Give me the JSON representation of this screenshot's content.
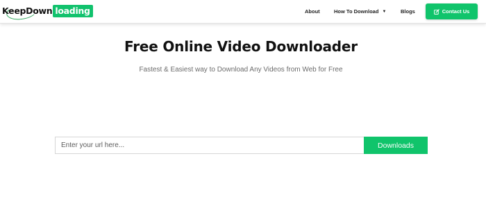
{
  "brand": {
    "logo_part1": "KeepDown",
    "logo_part2": "loading",
    "accent_color": "#10c46b"
  },
  "nav": {
    "about": "About",
    "how_to": "How To Download",
    "blogs": "Blogs",
    "contact": "Contact Us",
    "contact_icon": "edit-icon",
    "dropdown_icon": "chevron-down-icon"
  },
  "hero": {
    "title": "Free Online Video Downloader",
    "subtitle": "Fastest & Easiest way to Download Any Videos from Web for Free"
  },
  "search": {
    "placeholder": "Enter your url here...",
    "value": "",
    "button_label": "Downloads"
  }
}
